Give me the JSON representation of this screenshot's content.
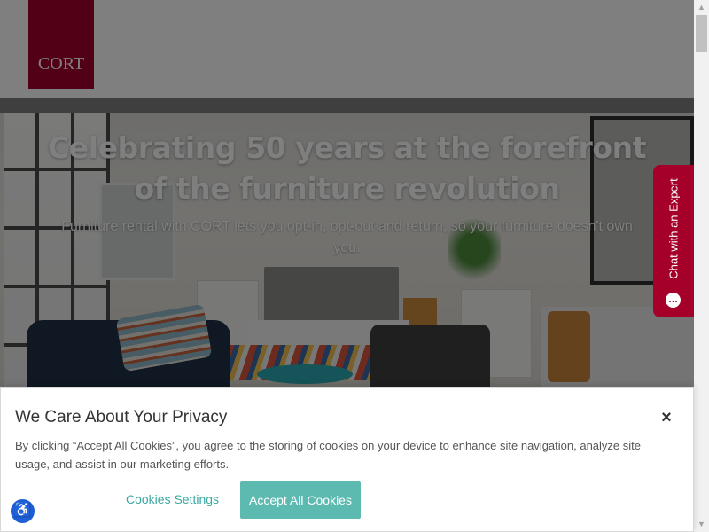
{
  "header": {
    "logo_text": "CORT",
    "brand_color": "#a5002a"
  },
  "hero": {
    "title_line1": "Celebrating 50 years at the forefront",
    "title_line2": "of the furniture revolution",
    "subtitle": "Furniture rental with CORT lets you opt-in, opt-out and return, so your furniture doesn't own you."
  },
  "chat": {
    "label": "Chat with an Expert",
    "icon": "chat-bubble-icon"
  },
  "cookie_banner": {
    "title": "We Care About Your Privacy",
    "close_icon": "×",
    "text": "By clicking “Accept All Cookies”, you agree to the storing of cookies on your device to enhance site navigation, analyze site usage, and assist in our marketing efforts.",
    "settings_label": "Cookies Settings",
    "accept_label": "Accept All Cookies",
    "accent_color": "#5dbab1"
  },
  "accessibility": {
    "icon": "accessibility-icon",
    "glyph": "♿"
  }
}
